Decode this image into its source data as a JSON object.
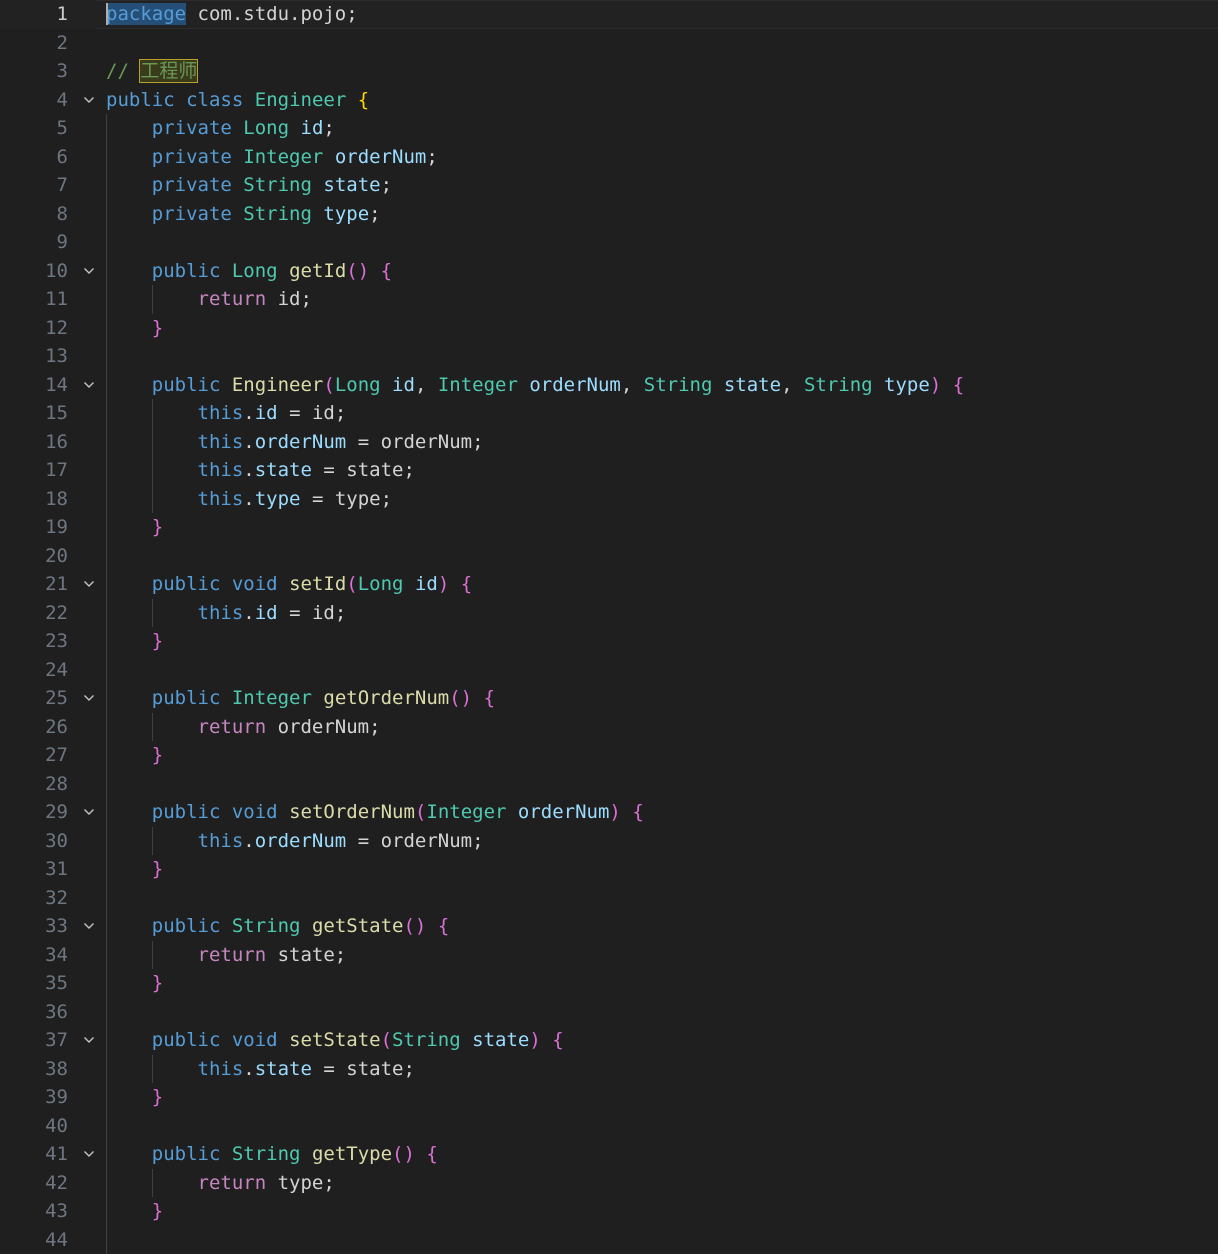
{
  "editor": {
    "language": "java",
    "current_line": 1,
    "fold_icon": "chevron-down-icon",
    "colors": {
      "background": "#1f1f1f",
      "keyword": "#569cd6",
      "control": "#c586c0",
      "type": "#4ec9b0",
      "variable": "#9cdcfe",
      "function": "#dcdcaa",
      "plain": "#d4d4d4",
      "comment": "#6a9955",
      "bracket_level1": "#ffd700",
      "bracket_level2": "#da70d6",
      "bracket_level3": "#179fff"
    },
    "lines": [
      {
        "num": "1",
        "fold": false,
        "tokens": [
          [
            "package",
            "sel"
          ],
          [
            " com.stdu.pojo;",
            "plain"
          ]
        ]
      },
      {
        "num": "2",
        "fold": false,
        "tokens": []
      },
      {
        "num": "3",
        "fold": false,
        "tokens": [
          [
            "// ",
            "cm"
          ],
          [
            "工程师",
            "cmhl"
          ]
        ]
      },
      {
        "num": "4",
        "fold": true,
        "tokens": [
          [
            "public",
            "kw"
          ],
          [
            " ",
            "plain"
          ],
          [
            "class",
            "kw"
          ],
          [
            " ",
            "plain"
          ],
          [
            "Engineer",
            "type"
          ],
          [
            " ",
            "plain"
          ],
          [
            "{",
            "b1"
          ]
        ]
      },
      {
        "num": "5",
        "fold": false,
        "tokens": [
          [
            "    ",
            "plain"
          ],
          [
            "private",
            "kw"
          ],
          [
            " ",
            "plain"
          ],
          [
            "Long",
            "type"
          ],
          [
            " ",
            "plain"
          ],
          [
            "id",
            "var"
          ],
          [
            ";",
            "plain"
          ]
        ]
      },
      {
        "num": "6",
        "fold": false,
        "tokens": [
          [
            "    ",
            "plain"
          ],
          [
            "private",
            "kw"
          ],
          [
            " ",
            "plain"
          ],
          [
            "Integer",
            "type"
          ],
          [
            " ",
            "plain"
          ],
          [
            "orderNum",
            "var"
          ],
          [
            ";",
            "plain"
          ]
        ]
      },
      {
        "num": "7",
        "fold": false,
        "tokens": [
          [
            "    ",
            "plain"
          ],
          [
            "private",
            "kw"
          ],
          [
            " ",
            "plain"
          ],
          [
            "String",
            "type"
          ],
          [
            " ",
            "plain"
          ],
          [
            "state",
            "var"
          ],
          [
            ";",
            "plain"
          ]
        ]
      },
      {
        "num": "8",
        "fold": false,
        "tokens": [
          [
            "    ",
            "plain"
          ],
          [
            "private",
            "kw"
          ],
          [
            " ",
            "plain"
          ],
          [
            "String",
            "type"
          ],
          [
            " ",
            "plain"
          ],
          [
            "type",
            "var"
          ],
          [
            ";",
            "plain"
          ]
        ]
      },
      {
        "num": "9",
        "fold": false,
        "tokens": []
      },
      {
        "num": "10",
        "fold": true,
        "tokens": [
          [
            "    ",
            "plain"
          ],
          [
            "public",
            "kw"
          ],
          [
            " ",
            "plain"
          ],
          [
            "Long",
            "type"
          ],
          [
            " ",
            "plain"
          ],
          [
            "getId",
            "fn"
          ],
          [
            "()",
            "b2"
          ],
          [
            " ",
            "plain"
          ],
          [
            "{",
            "b2"
          ]
        ]
      },
      {
        "num": "11",
        "fold": false,
        "tokens": [
          [
            "        ",
            "plain"
          ],
          [
            "return",
            "ctl"
          ],
          [
            " id;",
            "plain"
          ]
        ]
      },
      {
        "num": "12",
        "fold": false,
        "tokens": [
          [
            "    ",
            "plain"
          ],
          [
            "}",
            "b2"
          ]
        ]
      },
      {
        "num": "13",
        "fold": false,
        "tokens": []
      },
      {
        "num": "14",
        "fold": true,
        "tokens": [
          [
            "    ",
            "plain"
          ],
          [
            "public",
            "kw"
          ],
          [
            " ",
            "plain"
          ],
          [
            "Engineer",
            "fn"
          ],
          [
            "(",
            "b2"
          ],
          [
            "Long",
            "type"
          ],
          [
            " ",
            "plain"
          ],
          [
            "id",
            "var"
          ],
          [
            ", ",
            "plain"
          ],
          [
            "Integer",
            "type"
          ],
          [
            " ",
            "plain"
          ],
          [
            "orderNum",
            "var"
          ],
          [
            ", ",
            "plain"
          ],
          [
            "String",
            "type"
          ],
          [
            " ",
            "plain"
          ],
          [
            "state",
            "var"
          ],
          [
            ", ",
            "plain"
          ],
          [
            "String",
            "type"
          ],
          [
            " ",
            "plain"
          ],
          [
            "type",
            "var"
          ],
          [
            ")",
            "b2"
          ],
          [
            " ",
            "plain"
          ],
          [
            "{",
            "b2"
          ]
        ]
      },
      {
        "num": "15",
        "fold": false,
        "tokens": [
          [
            "        ",
            "plain"
          ],
          [
            "this",
            "kw"
          ],
          [
            ".",
            "plain"
          ],
          [
            "id",
            "var"
          ],
          [
            " = id;",
            "plain"
          ]
        ]
      },
      {
        "num": "16",
        "fold": false,
        "tokens": [
          [
            "        ",
            "plain"
          ],
          [
            "this",
            "kw"
          ],
          [
            ".",
            "plain"
          ],
          [
            "orderNum",
            "var"
          ],
          [
            " = orderNum;",
            "plain"
          ]
        ]
      },
      {
        "num": "17",
        "fold": false,
        "tokens": [
          [
            "        ",
            "plain"
          ],
          [
            "this",
            "kw"
          ],
          [
            ".",
            "plain"
          ],
          [
            "state",
            "var"
          ],
          [
            " = state;",
            "plain"
          ]
        ]
      },
      {
        "num": "18",
        "fold": false,
        "tokens": [
          [
            "        ",
            "plain"
          ],
          [
            "this",
            "kw"
          ],
          [
            ".",
            "plain"
          ],
          [
            "type",
            "var"
          ],
          [
            " = type;",
            "plain"
          ]
        ]
      },
      {
        "num": "19",
        "fold": false,
        "tokens": [
          [
            "    ",
            "plain"
          ],
          [
            "}",
            "b2"
          ]
        ]
      },
      {
        "num": "20",
        "fold": false,
        "tokens": []
      },
      {
        "num": "21",
        "fold": true,
        "tokens": [
          [
            "    ",
            "plain"
          ],
          [
            "public",
            "kw"
          ],
          [
            " ",
            "plain"
          ],
          [
            "void",
            "kw"
          ],
          [
            " ",
            "plain"
          ],
          [
            "setId",
            "fn"
          ],
          [
            "(",
            "b2"
          ],
          [
            "Long",
            "type"
          ],
          [
            " ",
            "plain"
          ],
          [
            "id",
            "var"
          ],
          [
            ")",
            "b2"
          ],
          [
            " ",
            "plain"
          ],
          [
            "{",
            "b2"
          ]
        ]
      },
      {
        "num": "22",
        "fold": false,
        "tokens": [
          [
            "        ",
            "plain"
          ],
          [
            "this",
            "kw"
          ],
          [
            ".",
            "plain"
          ],
          [
            "id",
            "var"
          ],
          [
            " = id;",
            "plain"
          ]
        ]
      },
      {
        "num": "23",
        "fold": false,
        "tokens": [
          [
            "    ",
            "plain"
          ],
          [
            "}",
            "b2"
          ]
        ]
      },
      {
        "num": "24",
        "fold": false,
        "tokens": []
      },
      {
        "num": "25",
        "fold": true,
        "tokens": [
          [
            "    ",
            "plain"
          ],
          [
            "public",
            "kw"
          ],
          [
            " ",
            "plain"
          ],
          [
            "Integer",
            "type"
          ],
          [
            " ",
            "plain"
          ],
          [
            "getOrderNum",
            "fn"
          ],
          [
            "()",
            "b2"
          ],
          [
            " ",
            "plain"
          ],
          [
            "{",
            "b2"
          ]
        ]
      },
      {
        "num": "26",
        "fold": false,
        "tokens": [
          [
            "        ",
            "plain"
          ],
          [
            "return",
            "ctl"
          ],
          [
            " orderNum;",
            "plain"
          ]
        ]
      },
      {
        "num": "27",
        "fold": false,
        "tokens": [
          [
            "    ",
            "plain"
          ],
          [
            "}",
            "b2"
          ]
        ]
      },
      {
        "num": "28",
        "fold": false,
        "tokens": []
      },
      {
        "num": "29",
        "fold": true,
        "tokens": [
          [
            "    ",
            "plain"
          ],
          [
            "public",
            "kw"
          ],
          [
            " ",
            "plain"
          ],
          [
            "void",
            "kw"
          ],
          [
            " ",
            "plain"
          ],
          [
            "setOrderNum",
            "fn"
          ],
          [
            "(",
            "b2"
          ],
          [
            "Integer",
            "type"
          ],
          [
            " ",
            "plain"
          ],
          [
            "orderNum",
            "var"
          ],
          [
            ")",
            "b2"
          ],
          [
            " ",
            "plain"
          ],
          [
            "{",
            "b2"
          ]
        ]
      },
      {
        "num": "30",
        "fold": false,
        "tokens": [
          [
            "        ",
            "plain"
          ],
          [
            "this",
            "kw"
          ],
          [
            ".",
            "plain"
          ],
          [
            "orderNum",
            "var"
          ],
          [
            " = orderNum;",
            "plain"
          ]
        ]
      },
      {
        "num": "31",
        "fold": false,
        "tokens": [
          [
            "    ",
            "plain"
          ],
          [
            "}",
            "b2"
          ]
        ]
      },
      {
        "num": "32",
        "fold": false,
        "tokens": []
      },
      {
        "num": "33",
        "fold": true,
        "tokens": [
          [
            "    ",
            "plain"
          ],
          [
            "public",
            "kw"
          ],
          [
            " ",
            "plain"
          ],
          [
            "String",
            "type"
          ],
          [
            " ",
            "plain"
          ],
          [
            "getState",
            "fn"
          ],
          [
            "()",
            "b2"
          ],
          [
            " ",
            "plain"
          ],
          [
            "{",
            "b2"
          ]
        ]
      },
      {
        "num": "34",
        "fold": false,
        "tokens": [
          [
            "        ",
            "plain"
          ],
          [
            "return",
            "ctl"
          ],
          [
            " state;",
            "plain"
          ]
        ]
      },
      {
        "num": "35",
        "fold": false,
        "tokens": [
          [
            "    ",
            "plain"
          ],
          [
            "}",
            "b2"
          ]
        ]
      },
      {
        "num": "36",
        "fold": false,
        "tokens": []
      },
      {
        "num": "37",
        "fold": true,
        "tokens": [
          [
            "    ",
            "plain"
          ],
          [
            "public",
            "kw"
          ],
          [
            " ",
            "plain"
          ],
          [
            "void",
            "kw"
          ],
          [
            " ",
            "plain"
          ],
          [
            "setState",
            "fn"
          ],
          [
            "(",
            "b2"
          ],
          [
            "String",
            "type"
          ],
          [
            " ",
            "plain"
          ],
          [
            "state",
            "var"
          ],
          [
            ")",
            "b2"
          ],
          [
            " ",
            "plain"
          ],
          [
            "{",
            "b2"
          ]
        ]
      },
      {
        "num": "38",
        "fold": false,
        "tokens": [
          [
            "        ",
            "plain"
          ],
          [
            "this",
            "kw"
          ],
          [
            ".",
            "plain"
          ],
          [
            "state",
            "var"
          ],
          [
            " = state;",
            "plain"
          ]
        ]
      },
      {
        "num": "39",
        "fold": false,
        "tokens": [
          [
            "    ",
            "plain"
          ],
          [
            "}",
            "b2"
          ]
        ]
      },
      {
        "num": "40",
        "fold": false,
        "tokens": []
      },
      {
        "num": "41",
        "fold": true,
        "tokens": [
          [
            "    ",
            "plain"
          ],
          [
            "public",
            "kw"
          ],
          [
            " ",
            "plain"
          ],
          [
            "String",
            "type"
          ],
          [
            " ",
            "plain"
          ],
          [
            "getType",
            "fn"
          ],
          [
            "()",
            "b2"
          ],
          [
            " ",
            "plain"
          ],
          [
            "{",
            "b2"
          ]
        ]
      },
      {
        "num": "42",
        "fold": false,
        "tokens": [
          [
            "        ",
            "plain"
          ],
          [
            "return",
            "ctl"
          ],
          [
            " type;",
            "plain"
          ]
        ]
      },
      {
        "num": "43",
        "fold": false,
        "tokens": [
          [
            "    ",
            "plain"
          ],
          [
            "}",
            "b2"
          ]
        ]
      },
      {
        "num": "44",
        "fold": false,
        "tokens": []
      }
    ]
  }
}
